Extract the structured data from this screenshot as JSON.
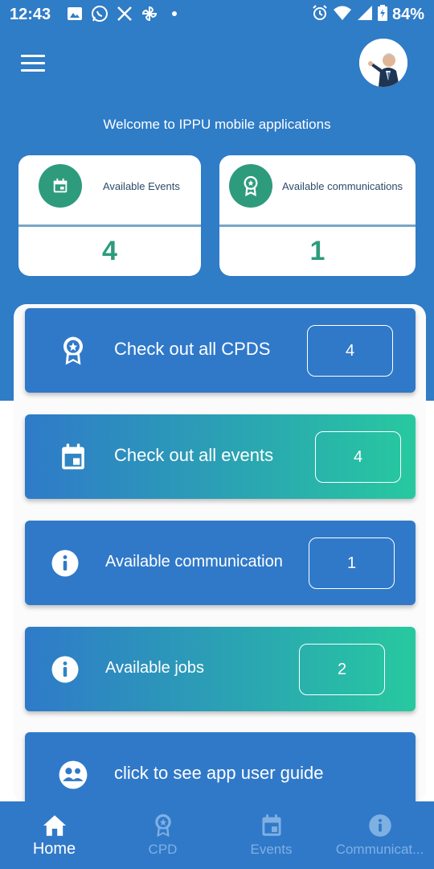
{
  "status_bar": {
    "time": "12:43",
    "battery": "84%",
    "left_icons": [
      "gallery-icon",
      "whatsapp-icon",
      "x-icon",
      "pinwheel-icon",
      "dot-icon"
    ],
    "right_icons": [
      "alarm-icon",
      "wifi-icon",
      "signal-icon",
      "battery-icon"
    ]
  },
  "header": {
    "menu_icon": "hamburger-menu-icon",
    "avatar": "profile-avatar",
    "welcome_text": "Welcome to IPPU mobile applications"
  },
  "stats": [
    {
      "label": "Available Events",
      "value": "4",
      "icon": "calendar-icon"
    },
    {
      "label": "Available communications",
      "value": "1",
      "icon": "award-icon"
    }
  ],
  "actions": [
    {
      "label": "Check out all CPDS",
      "count": "4",
      "icon": "award-icon"
    },
    {
      "label": "Check out all events",
      "count": "4",
      "icon": "calendar-icon"
    },
    {
      "label": "Available communication",
      "count": "1",
      "icon": "info-icon"
    },
    {
      "label": "Available jobs",
      "count": "2",
      "icon": "info-icon"
    },
    {
      "label": "click to see app user guide",
      "icon": "users-icon"
    }
  ],
  "bottom_nav": [
    {
      "label": "Home",
      "icon": "home-icon",
      "active": true
    },
    {
      "label": "CPD",
      "icon": "award-icon",
      "active": false
    },
    {
      "label": "Events",
      "icon": "calendar-icon",
      "active": false
    },
    {
      "label": "Communicat...",
      "icon": "info-icon",
      "active": false
    }
  ],
  "colors": {
    "primary": "#2f7cc7",
    "accent_green": "#2e9b7d",
    "gradient_end": "#27c9a0",
    "nav_inactive": "#7fb0e2"
  }
}
